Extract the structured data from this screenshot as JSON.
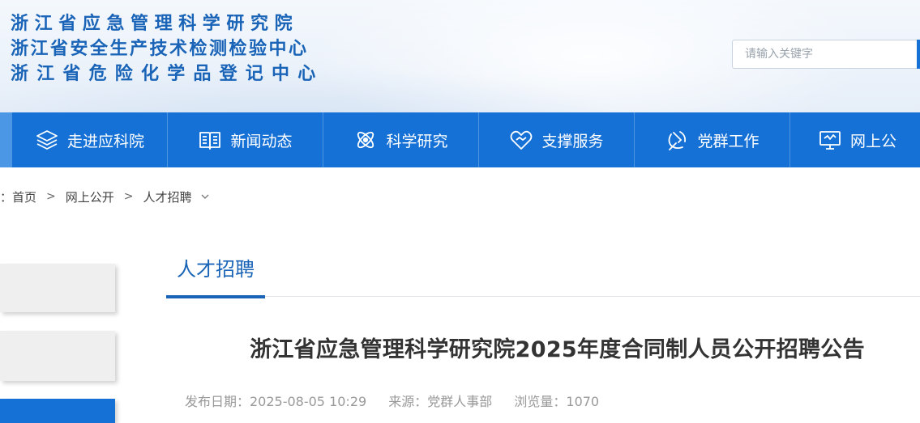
{
  "header": {
    "logo_lines": [
      "浙江省应急管理科学研究院",
      "浙江省安全生产技术检测检验中心",
      "浙江省危险化学品登记中心"
    ],
    "search_placeholder": "请输入关键字"
  },
  "nav": {
    "items": [
      {
        "label": "走进应科院",
        "icon": "layers-icon"
      },
      {
        "label": "新闻动态",
        "icon": "book-icon"
      },
      {
        "label": "科学研究",
        "icon": "atom-icon"
      },
      {
        "label": "支撑服务",
        "icon": "heart-handshake-icon"
      },
      {
        "label": "党群工作",
        "icon": "party-emblem-icon"
      },
      {
        "label": "网上公",
        "icon": "monitor-icon"
      }
    ]
  },
  "breadcrumb": {
    "prefix": "：",
    "items": [
      "首页",
      "网上公开",
      "人才招聘"
    ],
    "separator": ">"
  },
  "section": {
    "title": "人才招聘"
  },
  "article": {
    "title": "浙江省应急管理科学研究院2025年度合同制人员公开招聘公告",
    "publish_date": "发布日期：2025-08-05 10:29",
    "source": "来源：党群人事部",
    "views": "浏览量：1070"
  },
  "colors": {
    "brand_blue": "#1571d6",
    "logo_blue": "#1a64b8",
    "sidebar_active": "#1571d6"
  }
}
